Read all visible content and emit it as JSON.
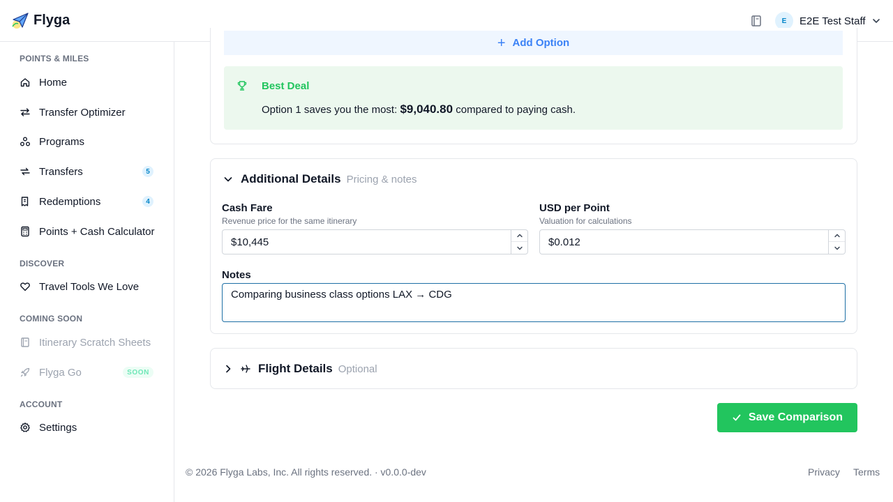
{
  "app": {
    "name": "Flyga"
  },
  "header": {
    "user_initial": "E",
    "user_name": "E2E Test Staff"
  },
  "sidebar": {
    "sections": [
      {
        "title": "POINTS & MILES"
      },
      {
        "title": "DISCOVER"
      },
      {
        "title": "COMING SOON"
      },
      {
        "title": "ACCOUNT"
      }
    ],
    "items": [
      {
        "label": "Home",
        "icon": "home-icon"
      },
      {
        "label": "Transfer Optimizer",
        "icon": "swap-arrows-icon"
      },
      {
        "label": "Programs",
        "icon": "programs-icon"
      },
      {
        "label": "Transfers",
        "icon": "transfer-icon",
        "badge": "5"
      },
      {
        "label": "Redemptions",
        "icon": "receipt-icon",
        "badge": "4"
      },
      {
        "label": "Points + Cash Calculator",
        "icon": "calculator-icon"
      },
      {
        "label": "Travel Tools We Love",
        "icon": "heart-icon"
      },
      {
        "label": "Itinerary Scratch Sheets",
        "icon": "notebook-icon"
      },
      {
        "label": "Flyga Go",
        "icon": "rocket-icon",
        "badge": "SOON"
      },
      {
        "label": "Settings",
        "icon": "gear-icon"
      }
    ]
  },
  "options": {
    "add_label": "Add Option"
  },
  "best_deal": {
    "title": "Best Deal",
    "text_before": "Option 1 saves you the most: ",
    "amount": "$9,040.80",
    "text_after": " compared to paying cash."
  },
  "details": {
    "title": "Additional Details",
    "subtitle": "Pricing & notes",
    "cash_fare": {
      "label": "Cash Fare",
      "help": "Revenue price for the same itinerary",
      "value": "$10,445"
    },
    "usd_per_point": {
      "label": "USD per Point",
      "help": "Valuation for calculations",
      "value": "$0.012"
    },
    "notes": {
      "label": "Notes",
      "value": "Comparing business class options LAX → CDG"
    }
  },
  "flight": {
    "title": "Flight Details",
    "subtitle": "Optional"
  },
  "save_label": "Save Comparison",
  "footer": {
    "copyright": "© 2026 Flyga Labs, Inc. All rights reserved. · v0.0.0-dev",
    "privacy": "Privacy",
    "terms": "Terms"
  },
  "colors": {
    "accent_green": "#22c55e",
    "accent_blue": "#3b82f6",
    "best_deal_bg": "#ecf8ee",
    "badge_blue": "#0284c7"
  }
}
